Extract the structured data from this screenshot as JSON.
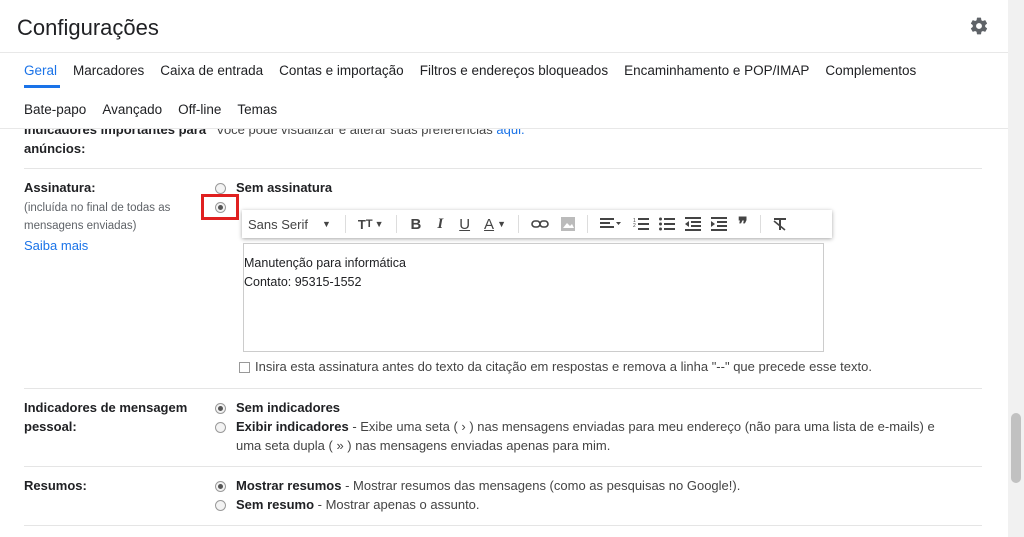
{
  "header": {
    "title": "Configurações",
    "settings_icon": "gear-icon"
  },
  "tabs_row1": [
    "Geral",
    "Marcadores",
    "Caixa de entrada",
    "Contas e importação",
    "Filtros e endereços bloqueados",
    "Encaminhamento e POP/IMAP",
    "Complementos"
  ],
  "tabs_row2": [
    "Bate-papo",
    "Avançado",
    "Off-line",
    "Temas"
  ],
  "active_tab": "Geral",
  "partial_section": {
    "label_line1": "Indicadores importantes para",
    "label_line2": "anúncios:",
    "text": "Você pode visualizar e alterar suas preferências",
    "link": "aqui."
  },
  "signature": {
    "label": "Assinatura:",
    "sub_line1": "(incluída no final de todas as",
    "sub_line2": "mensagens enviadas)",
    "learn_more": "Saiba mais",
    "option_none": "Sem assinatura",
    "toolbar": {
      "font": "Sans Serif",
      "bold": "B",
      "italic": "I",
      "underline": "U",
      "text_color": "A",
      "quote": "❞"
    },
    "editor_line1": "Manutenção para informática",
    "editor_line2": "Contato: 95315-1552",
    "checkbox_label": "Insira esta assinatura antes do texto da citação em respostas e remova a linha \"--\" que precede esse texto."
  },
  "personal_indicators": {
    "label_line1": "Indicadores de mensagem",
    "label_line2": "pessoal:",
    "opt1": "Sem indicadores",
    "opt2_bold": "Exibir indicadores",
    "opt2_text": " - Exibe uma seta ( › ) nas mensagens enviadas para meu endereço (não para uma lista de e-mails) e",
    "opt2_text2": "uma seta dupla ( » ) nas mensagens enviadas apenas para mim."
  },
  "snippets": {
    "label": "Resumos:",
    "opt1_bold": "Mostrar resumos",
    "opt1_text": " - Mostrar resumos das mensagens (como as pesquisas no Google!).",
    "opt2_bold": "Sem resumo",
    "opt2_text": " - Mostrar apenas o assunto."
  },
  "colors": {
    "accent": "#1a73e8",
    "highlight": "#e02020"
  }
}
